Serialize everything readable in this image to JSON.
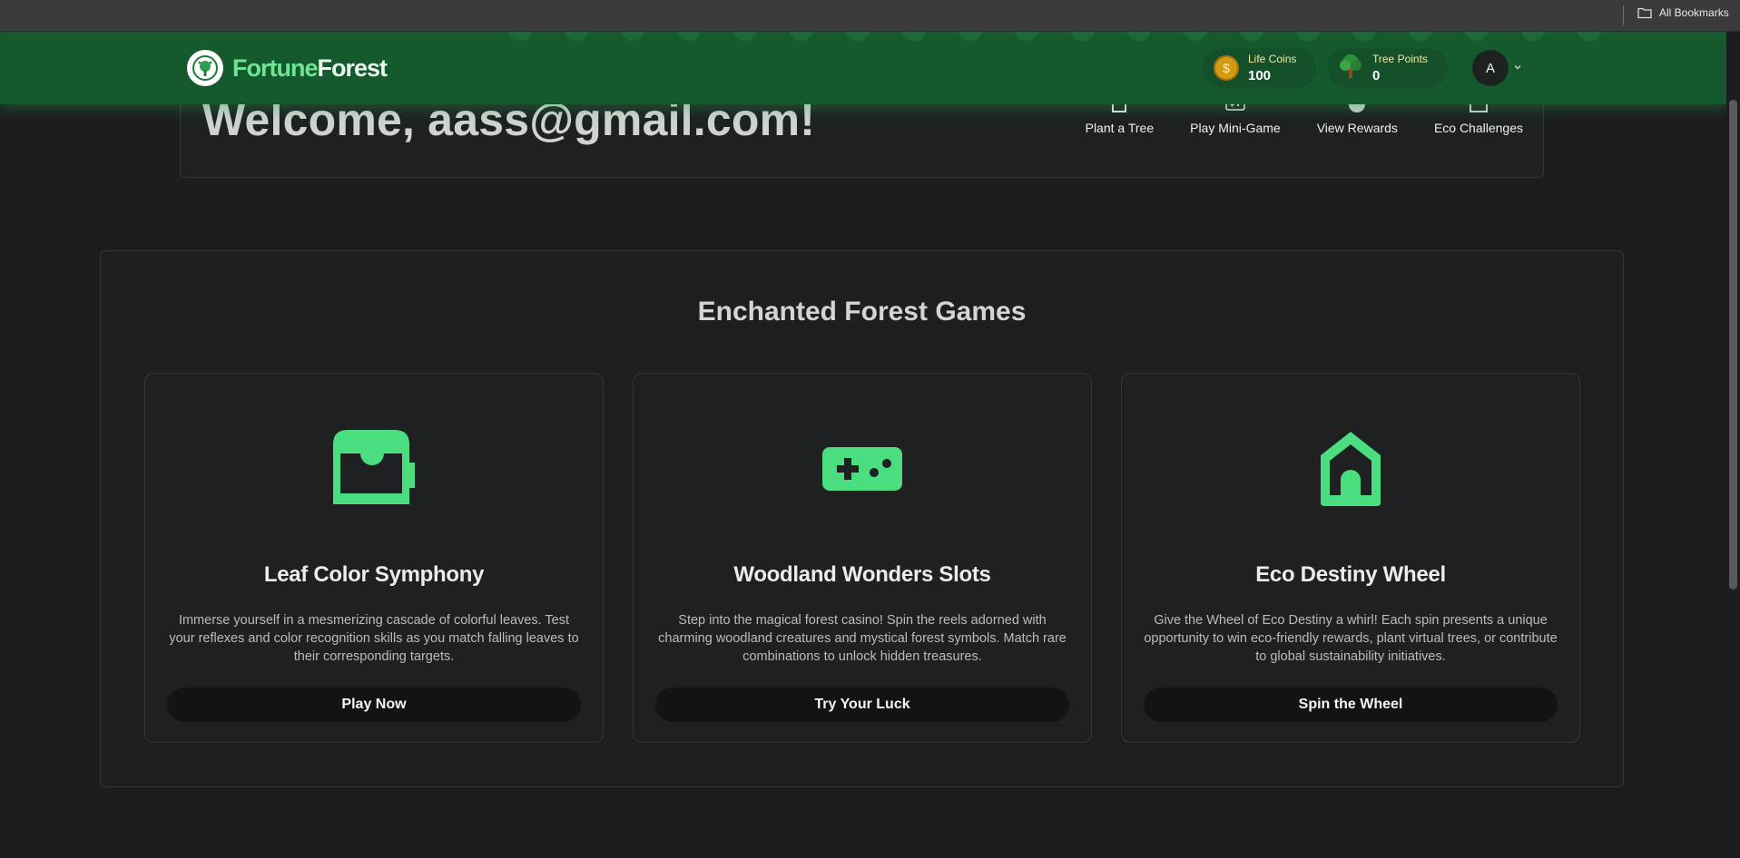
{
  "browser": {
    "bookmarks_label": "All Bookmarks"
  },
  "header": {
    "logo_part1": "Fortune",
    "logo_part2": "Forest",
    "life_coins": {
      "label": "Life Coins",
      "value": "100",
      "icon_glyph": "$"
    },
    "tree_points": {
      "label": "Tree Points",
      "value": "0"
    },
    "avatar_initial": "A"
  },
  "welcome": {
    "title": "Welcome, aass@gmail.com!",
    "nav": [
      {
        "label": "Plant a Tree",
        "icon": "house-icon"
      },
      {
        "label": "Play Mini-Game",
        "icon": "gamepad-icon"
      },
      {
        "label": "View Rewards",
        "icon": "circle-icon"
      },
      {
        "label": "Eco Challenges",
        "icon": "tray-icon"
      }
    ]
  },
  "games": {
    "title": "Enchanted Forest Games",
    "cards": [
      {
        "name": "Leaf Color Symphony",
        "description": "Immerse yourself in a mesmerizing cascade of colorful leaves. Test your reflexes and color recognition skills as you match falling leaves to their corresponding targets.",
        "button": "Play Now",
        "icon": "tray-icon"
      },
      {
        "name": "Woodland Wonders Slots",
        "description": "Step into the magical forest casino! Spin the reels adorned with charming woodland creatures and mystical forest symbols. Match rare combinations to unlock hidden treasures.",
        "button": "Try Your Luck",
        "icon": "gamepad-icon"
      },
      {
        "name": "Eco Destiny Wheel",
        "description": "Give the Wheel of Eco Destiny a whirl! Each spin presents a unique opportunity to win eco-friendly rewards, plant virtual trees, or contribute to global sustainability initiatives.",
        "button": "Spin the Wheel",
        "icon": "house-icon"
      }
    ]
  },
  "colors": {
    "header_bg": "#155a2c",
    "accent_green": "#4ade80",
    "page_bg": "#1c1d1f",
    "coin": "#d39a13"
  }
}
